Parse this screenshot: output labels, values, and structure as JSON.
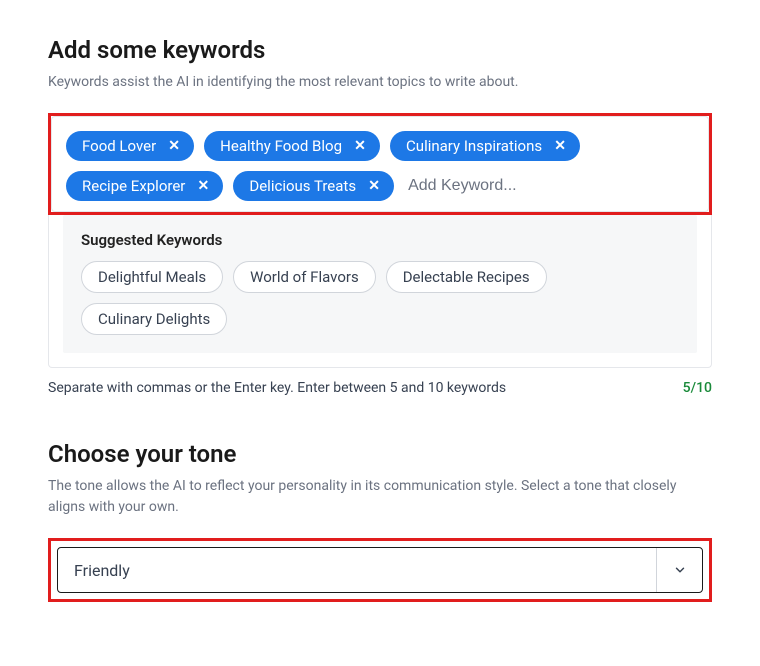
{
  "keywords": {
    "title": "Add some keywords",
    "description": "Keywords assist the AI in identifying the most relevant topics to write about.",
    "tags": [
      "Food Lover",
      "Healthy Food Blog",
      "Culinary Inspirations",
      "Recipe Explorer",
      "Delicious Treats"
    ],
    "input_placeholder": "Add Keyword...",
    "suggested_title": "Suggested Keywords",
    "suggested": [
      "Delightful Meals",
      "World of Flavors",
      "Delectable Recipes",
      "Culinary Delights"
    ],
    "helper": "Separate with commas or the Enter key. Enter between 5 and 10 keywords",
    "counter": "5/10"
  },
  "tone": {
    "title": "Choose your tone",
    "description": "The tone allows the AI to reflect your personality in its communication style. Select a tone that closely aligns with your own.",
    "selected": "Friendly"
  }
}
